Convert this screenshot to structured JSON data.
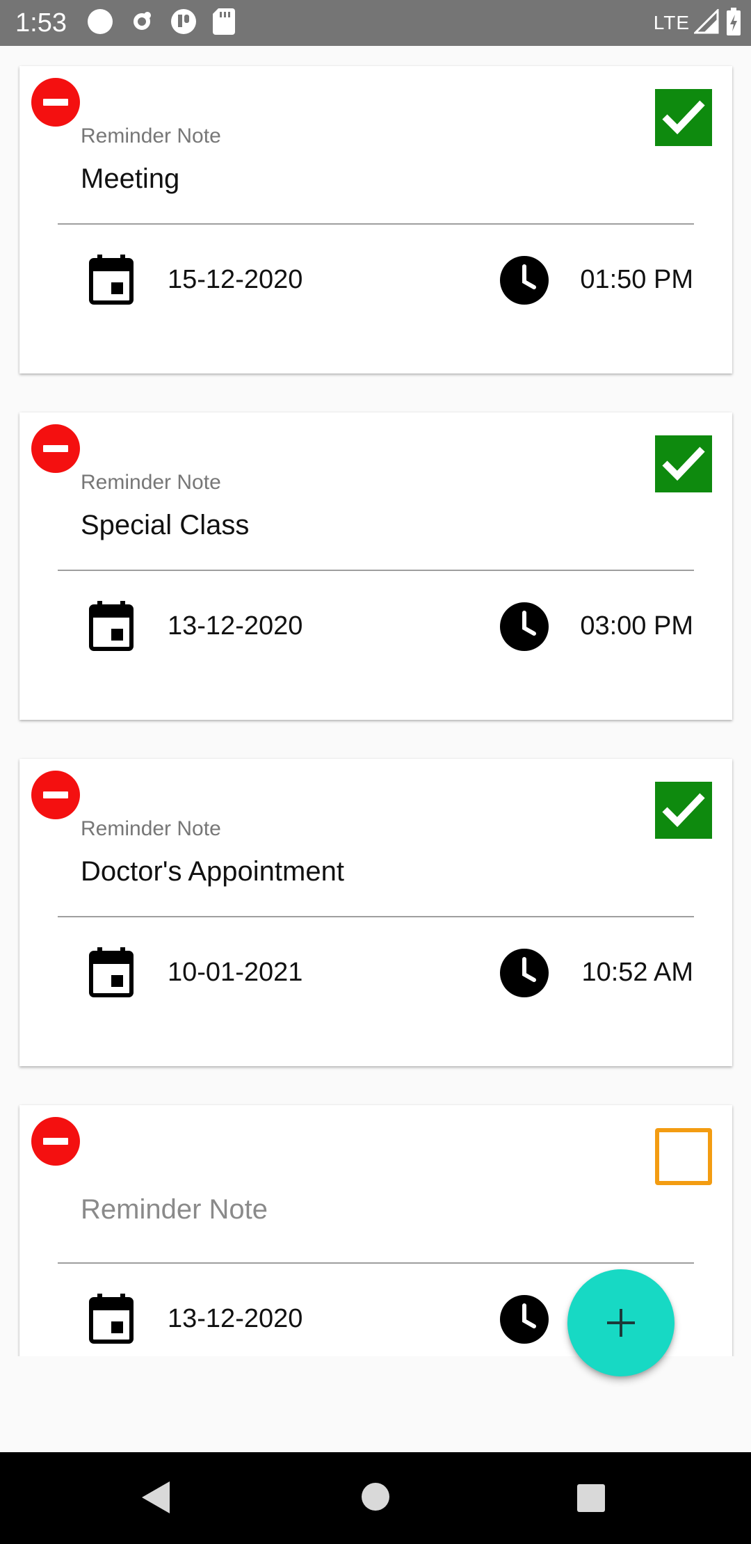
{
  "status_bar": {
    "time": "1:53",
    "network": "LTE",
    "icons": [
      "circle-icon",
      "gear-icon",
      "shield-icon",
      "sd-card-icon",
      "signal-icon",
      "battery-icon"
    ]
  },
  "reminders": [
    {
      "label": "Reminder Note",
      "note": "Meeting",
      "placeholder": "",
      "date": "15-12-2020",
      "time": "01:50 PM",
      "checked": true
    },
    {
      "label": "Reminder Note",
      "note": "Special Class",
      "placeholder": "",
      "date": "13-12-2020",
      "time": "03:00 PM",
      "checked": true
    },
    {
      "label": "Reminder Note",
      "note": "Doctor's Appointment",
      "placeholder": "",
      "date": "10-01-2021",
      "time": "10:52 AM",
      "checked": true
    },
    {
      "label": "",
      "note": "",
      "placeholder": "Reminder Note",
      "date": "13-12-2020",
      "time": "",
      "checked": false
    }
  ],
  "fab": {
    "icon": "plus-icon"
  },
  "nav_bar": {
    "icons": [
      "back-icon",
      "home-icon",
      "recents-icon"
    ]
  },
  "colors": {
    "remove": "#f41010",
    "checked": "#0e8a0e",
    "unchecked_border": "#f39c12",
    "fab": "#17d9c4",
    "status_bar": "#757575"
  }
}
